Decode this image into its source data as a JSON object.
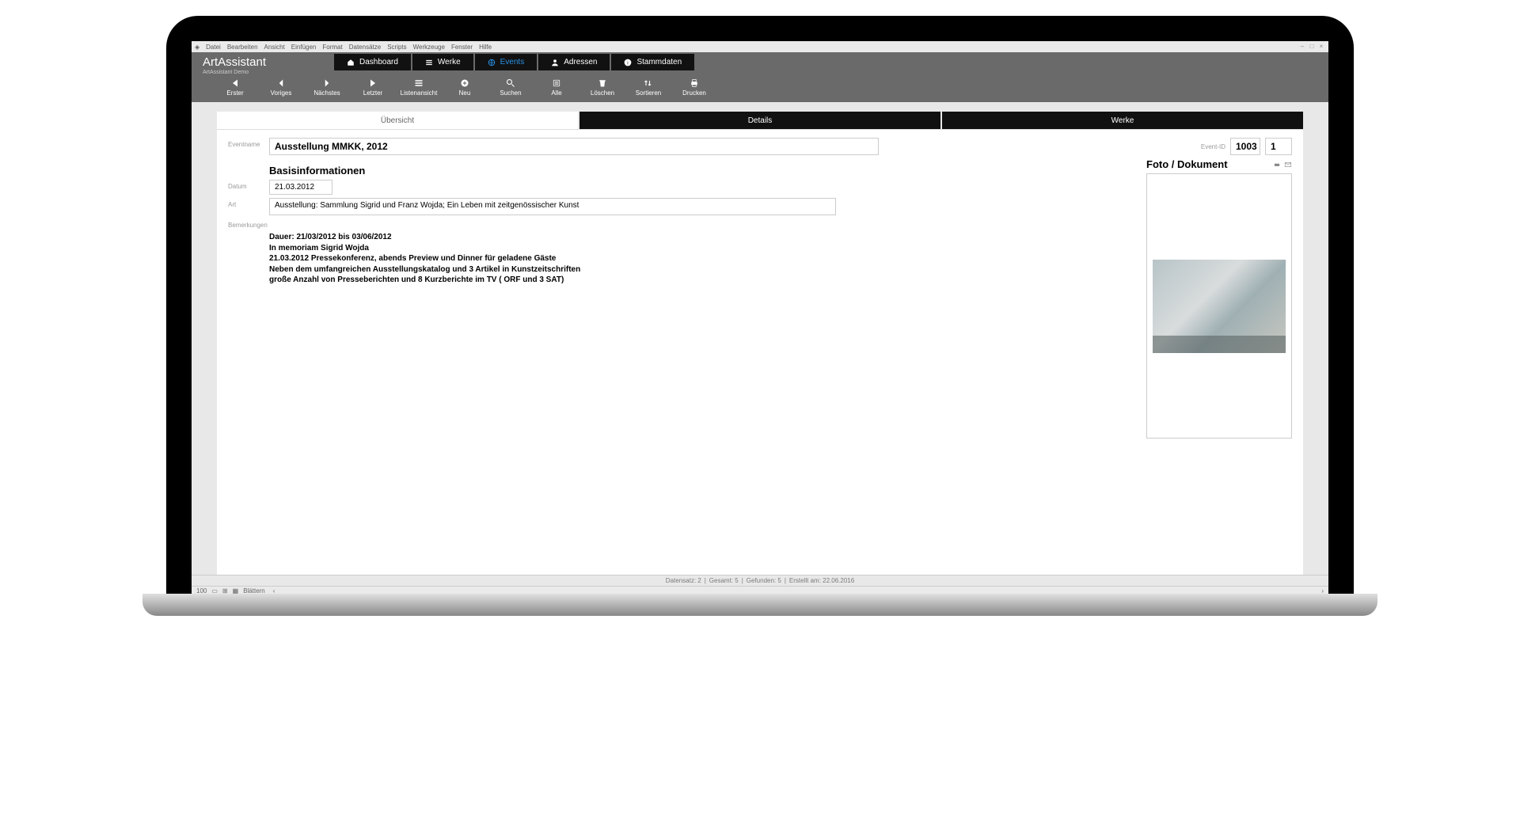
{
  "menu": {
    "items": [
      "Datei",
      "Bearbeiten",
      "Ansicht",
      "Einfügen",
      "Format",
      "Datensätze",
      "Scripts",
      "Werkzeuge",
      "Fenster",
      "Hilfe"
    ]
  },
  "brand": {
    "name": "ArtAssistant",
    "sub": "ArtAssistant Demo"
  },
  "nav": {
    "dashboard": "Dashboard",
    "werke": "Werke",
    "events": "Events",
    "adressen": "Adressen",
    "stammdaten": "Stammdaten"
  },
  "toolbar": {
    "erster": "Erster",
    "voriges": "Voriges",
    "naechstes": "Nächstes",
    "letzter": "Letzter",
    "listenansicht": "Listenansicht",
    "neu": "Neu",
    "suchen": "Suchen",
    "alle": "Alle",
    "loeschen": "Löschen",
    "sortieren": "Sortieren",
    "drucken": "Drucken"
  },
  "tabs": {
    "uebersicht": "Übersicht",
    "details": "Details",
    "werke": "Werke"
  },
  "labels": {
    "eventname": "Eventname",
    "eventid": "Event-ID",
    "basis": "Basisinformationen",
    "datum": "Datum",
    "art": "Art",
    "bemerkungen": "Bemerkungen",
    "foto": "Foto / Dokument"
  },
  "form": {
    "eventname": "Ausstellung MMKK, 2012",
    "eventid": "1003",
    "eventid2": "1",
    "datum": "21.03.2012",
    "art": "Ausstellung: Sammlung Sigrid und Franz Wojda; Ein Leben mit zeitgenössischer Kunst",
    "bem1": "Dauer: 21/03/2012 bis 03/06/2012",
    "bem2": "In memoriam Sigrid Wojda",
    "bem3": "21.03.2012 Pressekonferenz, abends Preview und Dinner für geladene Gäste",
    "bem4": "Neben dem umfangreichen Ausstellungskatalog und 3 Artikel in Kunstzeitschriften",
    "bem5": "große Anzahl von Presseberichten und 8 Kurzberichte im TV ( ORF und 3 SAT)"
  },
  "status": {
    "datensatz": "Datensatz: 2",
    "gesamt": "Gesamt: 5",
    "gefunden": "Gefunden: 5",
    "erstellt": "Erstellt am: 22.06.2016"
  },
  "bottom": {
    "zoom": "100",
    "mode": "Blättern"
  }
}
